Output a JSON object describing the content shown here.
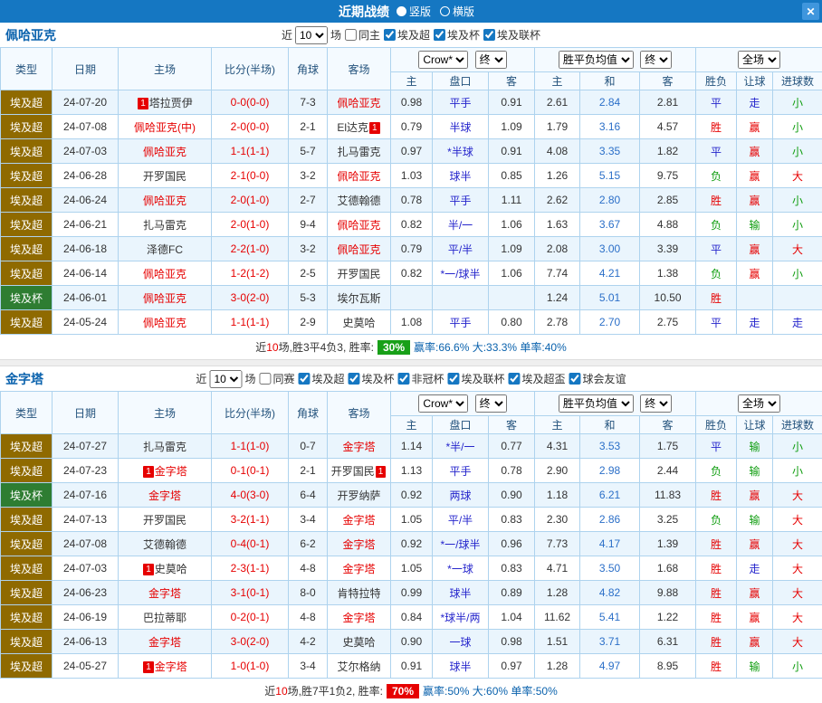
{
  "titlebar": {
    "title": "近期战绩",
    "radio_vertical": "竖版",
    "radio_horizontal": "横版",
    "close": "✕"
  },
  "colors": {
    "titlebar_bg": "#1577c2",
    "close_bg": "#3f96dd",
    "grid_border": "#aed3ee",
    "alt_row_bg": "#eaf5fd",
    "team_accent": "#0a62ad",
    "focus_team": "#e60000",
    "handicap_text": "#2525cc",
    "draw_odds_text": "#2b6fc8"
  },
  "league_colors": {
    "埃及超": "#8f6a00",
    "埃及杯": "#2e7d32"
  },
  "result_colors": {
    "胜": "#e60000",
    "负": "#0f9d0f",
    "平": "#2525cc",
    "赢": "#e60000",
    "输": "#0f9d0f",
    "走": "#2525cc",
    "大": "#e60000",
    "小": "#0f9d0f"
  },
  "sections": [
    {
      "team": "佩哈亚克",
      "filters": {
        "near": "近",
        "count": "10",
        "matches": "场",
        "checkboxes": [
          {
            "label": "同主",
            "checked": false
          },
          {
            "label": "埃及超",
            "checked": true
          },
          {
            "label": "埃及杯",
            "checked": true
          },
          {
            "label": "埃及联杯",
            "checked": true
          }
        ]
      },
      "header": {
        "type": "类型",
        "date": "日期",
        "home": "主场",
        "score": "比分(半场)",
        "corner": "角球",
        "away": "客场",
        "odds_company": "Crow*",
        "odds_stage": "终",
        "avg_label": "胜平负均值",
        "avg_stage": "终",
        "scope": "全场",
        "sub_home": "主",
        "sub_handicap": "盘口",
        "sub_away": "客",
        "sub_win": "主",
        "sub_draw": "和",
        "sub_lose": "客",
        "sub_result": "胜负",
        "sub_ah": "让球",
        "sub_goals": "进球数"
      },
      "rows": [
        {
          "league": "埃及超",
          "date": "24-07-20",
          "home": {
            "name": "塔拉贾伊",
            "badge": "1",
            "badge_pos": "left",
            "red": false
          },
          "score": "0-0(0-0)",
          "corner": "7-3",
          "away": {
            "name": "佩哈亚克",
            "red": true
          },
          "ah": [
            "0.98",
            "平手",
            "0.91"
          ],
          "odds": [
            "2.61",
            "2.84",
            "2.81"
          ],
          "res": [
            "平",
            "走",
            "小"
          ]
        },
        {
          "league": "埃及超",
          "date": "24-07-08",
          "home": {
            "name": "佩哈亚克(中)",
            "red": true
          },
          "score": "2-0(0-0)",
          "corner": "2-1",
          "away": {
            "name": "El达克",
            "badge": "1",
            "badge_pos": "right",
            "red": false
          },
          "ah": [
            "0.79",
            "半球",
            "1.09"
          ],
          "odds": [
            "1.79",
            "3.16",
            "4.57"
          ],
          "res": [
            "胜",
            "赢",
            "小"
          ]
        },
        {
          "league": "埃及超",
          "date": "24-07-03",
          "home": {
            "name": "佩哈亚克",
            "red": true
          },
          "score": "1-1(1-1)",
          "corner": "5-7",
          "away": {
            "name": "扎马雷克",
            "red": false
          },
          "ah": [
            "0.97",
            "*半球",
            "0.91"
          ],
          "odds": [
            "4.08",
            "3.35",
            "1.82"
          ],
          "res": [
            "平",
            "赢",
            "小"
          ]
        },
        {
          "league": "埃及超",
          "date": "24-06-28",
          "home": {
            "name": "开罗国民",
            "red": false
          },
          "score": "2-1(0-0)",
          "corner": "3-2",
          "away": {
            "name": "佩哈亚克",
            "red": true
          },
          "ah": [
            "1.03",
            "球半",
            "0.85"
          ],
          "odds": [
            "1.26",
            "5.15",
            "9.75"
          ],
          "res": [
            "负",
            "赢",
            "大"
          ]
        },
        {
          "league": "埃及超",
          "date": "24-06-24",
          "home": {
            "name": "佩哈亚克",
            "red": true
          },
          "score": "2-0(1-0)",
          "corner": "2-7",
          "away": {
            "name": "艾德翰德",
            "red": false
          },
          "ah": [
            "0.78",
            "平手",
            "1.11"
          ],
          "odds": [
            "2.62",
            "2.80",
            "2.85"
          ],
          "res": [
            "胜",
            "赢",
            "小"
          ]
        },
        {
          "league": "埃及超",
          "date": "24-06-21",
          "home": {
            "name": "扎马雷克",
            "red": false
          },
          "score": "2-0(1-0)",
          "corner": "9-4",
          "away": {
            "name": "佩哈亚克",
            "red": true
          },
          "ah": [
            "0.82",
            "半/一",
            "1.06"
          ],
          "odds": [
            "1.63",
            "3.67",
            "4.88"
          ],
          "res": [
            "负",
            "输",
            "小"
          ]
        },
        {
          "league": "埃及超",
          "date": "24-06-18",
          "home": {
            "name": "泽德FC",
            "red": false
          },
          "score": "2-2(1-0)",
          "corner": "3-2",
          "away": {
            "name": "佩哈亚克",
            "red": true
          },
          "ah": [
            "0.79",
            "平/半",
            "1.09"
          ],
          "odds": [
            "2.08",
            "3.00",
            "3.39"
          ],
          "res": [
            "平",
            "赢",
            "大"
          ]
        },
        {
          "league": "埃及超",
          "date": "24-06-14",
          "home": {
            "name": "佩哈亚克",
            "red": true
          },
          "score": "1-2(1-2)",
          "corner": "2-5",
          "away": {
            "name": "开罗国民",
            "red": false
          },
          "ah": [
            "0.82",
            "*一/球半",
            "1.06"
          ],
          "odds": [
            "7.74",
            "4.21",
            "1.38"
          ],
          "res": [
            "负",
            "赢",
            "小"
          ]
        },
        {
          "league": "埃及杯",
          "date": "24-06-01",
          "home": {
            "name": "佩哈亚克",
            "red": true
          },
          "score": "3-0(2-0)",
          "corner": "5-3",
          "away": {
            "name": "埃尔瓦斯",
            "red": false
          },
          "ah": [
            "",
            "",
            ""
          ],
          "odds": [
            "1.24",
            "5.01",
            "10.50"
          ],
          "res": [
            "胜",
            "",
            ""
          ]
        },
        {
          "league": "埃及超",
          "date": "24-05-24",
          "home": {
            "name": "佩哈亚克",
            "red": true
          },
          "score": "1-1(1-1)",
          "corner": "2-9",
          "away": {
            "name": "史莫哈",
            "red": false
          },
          "ah": [
            "1.08",
            "平手",
            "0.80"
          ],
          "odds": [
            "2.78",
            "2.70",
            "2.75"
          ],
          "res": [
            "平",
            "走",
            "走"
          ]
        }
      ],
      "summary": {
        "near": "近",
        "count": "10",
        "text": "场,胜3平4负3, 胜率:",
        "rate": "30%",
        "rate_bg": "#18a018",
        "tail": "赢率:66.6% 大:33.3% 单率:40%"
      }
    },
    {
      "team": "金字塔",
      "filters": {
        "near": "近",
        "count": "10",
        "matches": "场",
        "checkboxes": [
          {
            "label": "同赛",
            "checked": false
          },
          {
            "label": "埃及超",
            "checked": true
          },
          {
            "label": "埃及杯",
            "checked": true
          },
          {
            "label": "非冠杯",
            "checked": true
          },
          {
            "label": "埃及联杯",
            "checked": true
          },
          {
            "label": "埃及超盃",
            "checked": true
          },
          {
            "label": "球会友谊",
            "checked": true
          }
        ]
      },
      "header": {
        "type": "类型",
        "date": "日期",
        "home": "主场",
        "score": "比分(半场)",
        "corner": "角球",
        "away": "客场",
        "odds_company": "Crow*",
        "odds_stage": "终",
        "avg_label": "胜平负均值",
        "avg_stage": "终",
        "scope": "全场",
        "sub_home": "主",
        "sub_handicap": "盘口",
        "sub_away": "客",
        "sub_win": "主",
        "sub_draw": "和",
        "sub_lose": "客",
        "sub_result": "胜负",
        "sub_ah": "让球",
        "sub_goals": "进球数"
      },
      "rows": [
        {
          "league": "埃及超",
          "date": "24-07-27",
          "home": {
            "name": "扎马雷克",
            "red": false
          },
          "score": "1-1(1-0)",
          "corner": "0-7",
          "away": {
            "name": "金字塔",
            "red": true
          },
          "ah": [
            "1.14",
            "*半/一",
            "0.77"
          ],
          "odds": [
            "4.31",
            "3.53",
            "1.75"
          ],
          "res": [
            "平",
            "输",
            "小"
          ]
        },
        {
          "league": "埃及超",
          "date": "24-07-23",
          "home": {
            "name": "金字塔",
            "badge": "1",
            "badge_pos": "left",
            "red": true
          },
          "score": "0-1(0-1)",
          "corner": "2-1",
          "away": {
            "name": "开罗国民",
            "badge": "1",
            "badge_pos": "right",
            "red": false
          },
          "ah": [
            "1.13",
            "平手",
            "0.78"
          ],
          "odds": [
            "2.90",
            "2.98",
            "2.44"
          ],
          "res": [
            "负",
            "输",
            "小"
          ]
        },
        {
          "league": "埃及杯",
          "date": "24-07-16",
          "home": {
            "name": "金字塔",
            "red": true
          },
          "score": "4-0(3-0)",
          "corner": "6-4",
          "away": {
            "name": "开罗纳萨",
            "red": false
          },
          "ah": [
            "0.92",
            "两球",
            "0.90"
          ],
          "odds": [
            "1.18",
            "6.21",
            "11.83"
          ],
          "res": [
            "胜",
            "赢",
            "大"
          ]
        },
        {
          "league": "埃及超",
          "date": "24-07-13",
          "home": {
            "name": "开罗国民",
            "red": false
          },
          "score": "3-2(1-1)",
          "corner": "3-4",
          "away": {
            "name": "金字塔",
            "red": true
          },
          "ah": [
            "1.05",
            "平/半",
            "0.83"
          ],
          "odds": [
            "2.30",
            "2.86",
            "3.25"
          ],
          "res": [
            "负",
            "输",
            "大"
          ]
        },
        {
          "league": "埃及超",
          "date": "24-07-08",
          "home": {
            "name": "艾德翰德",
            "red": false
          },
          "score": "0-4(0-1)",
          "corner": "6-2",
          "away": {
            "name": "金字塔",
            "red": true
          },
          "ah": [
            "0.92",
            "*一/球半",
            "0.96"
          ],
          "odds": [
            "7.73",
            "4.17",
            "1.39"
          ],
          "res": [
            "胜",
            "赢",
            "大"
          ]
        },
        {
          "league": "埃及超",
          "date": "24-07-03",
          "home": {
            "name": "史莫哈",
            "badge": "1",
            "badge_pos": "left",
            "red": false
          },
          "score": "2-3(1-1)",
          "corner": "4-8",
          "away": {
            "name": "金字塔",
            "red": true
          },
          "ah": [
            "1.05",
            "*一球",
            "0.83"
          ],
          "odds": [
            "4.71",
            "3.50",
            "1.68"
          ],
          "res": [
            "胜",
            "走",
            "大"
          ]
        },
        {
          "league": "埃及超",
          "date": "24-06-23",
          "home": {
            "name": "金字塔",
            "red": true
          },
          "score": "3-1(0-1)",
          "corner": "8-0",
          "away": {
            "name": "肯特拉特",
            "red": false
          },
          "ah": [
            "0.99",
            "球半",
            "0.89"
          ],
          "odds": [
            "1.28",
            "4.82",
            "9.88"
          ],
          "res": [
            "胜",
            "赢",
            "大"
          ]
        },
        {
          "league": "埃及超",
          "date": "24-06-19",
          "home": {
            "name": "巴拉蒂耶",
            "red": false
          },
          "score": "0-2(0-1)",
          "corner": "4-8",
          "away": {
            "name": "金字塔",
            "red": true
          },
          "ah": [
            "0.84",
            "*球半/两",
            "1.04"
          ],
          "odds": [
            "11.62",
            "5.41",
            "1.22"
          ],
          "res": [
            "胜",
            "赢",
            "大"
          ]
        },
        {
          "league": "埃及超",
          "date": "24-06-13",
          "home": {
            "name": "金字塔",
            "red": true
          },
          "score": "3-0(2-0)",
          "corner": "4-2",
          "away": {
            "name": "史莫哈",
            "red": false
          },
          "ah": [
            "0.90",
            "一球",
            "0.98"
          ],
          "odds": [
            "1.51",
            "3.71",
            "6.31"
          ],
          "res": [
            "胜",
            "赢",
            "大"
          ]
        },
        {
          "league": "埃及超",
          "date": "24-05-27",
          "home": {
            "name": "金字塔",
            "badge": "1",
            "badge_pos": "left",
            "red": true
          },
          "score": "1-0(1-0)",
          "corner": "3-4",
          "away": {
            "name": "艾尔格纳",
            "red": false
          },
          "ah": [
            "0.91",
            "球半",
            "0.97"
          ],
          "odds": [
            "1.28",
            "4.97",
            "8.95"
          ],
          "res": [
            "胜",
            "输",
            "小"
          ]
        }
      ],
      "summary": {
        "near": "近",
        "count": "10",
        "text": "场,胜7平1负2, 胜率:",
        "rate": "70%",
        "rate_bg": "#e60000",
        "tail": "赢率:50% 大:60% 单率:50%"
      }
    }
  ]
}
